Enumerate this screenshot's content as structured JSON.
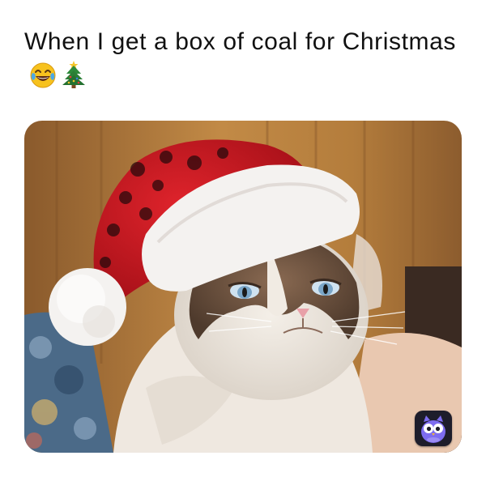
{
  "post": {
    "caption": "When I get a box of coal for Christmas",
    "caption_emojis": [
      "face-with-tears-of-joy-icon",
      "christmas-tree-icon"
    ]
  },
  "image": {
    "subject_icon": "grumpy-cat-santa-hat-photo"
  },
  "badge": {
    "icon": "owl-app-icon"
  },
  "colors": {
    "text": "#111111",
    "hat_red": "#c8141c",
    "hat_white": "#f4f2f0",
    "background_wood": "#b47d3c",
    "badge_bg": "#1d1d2b",
    "owl_purple": "#7d6cf0"
  }
}
